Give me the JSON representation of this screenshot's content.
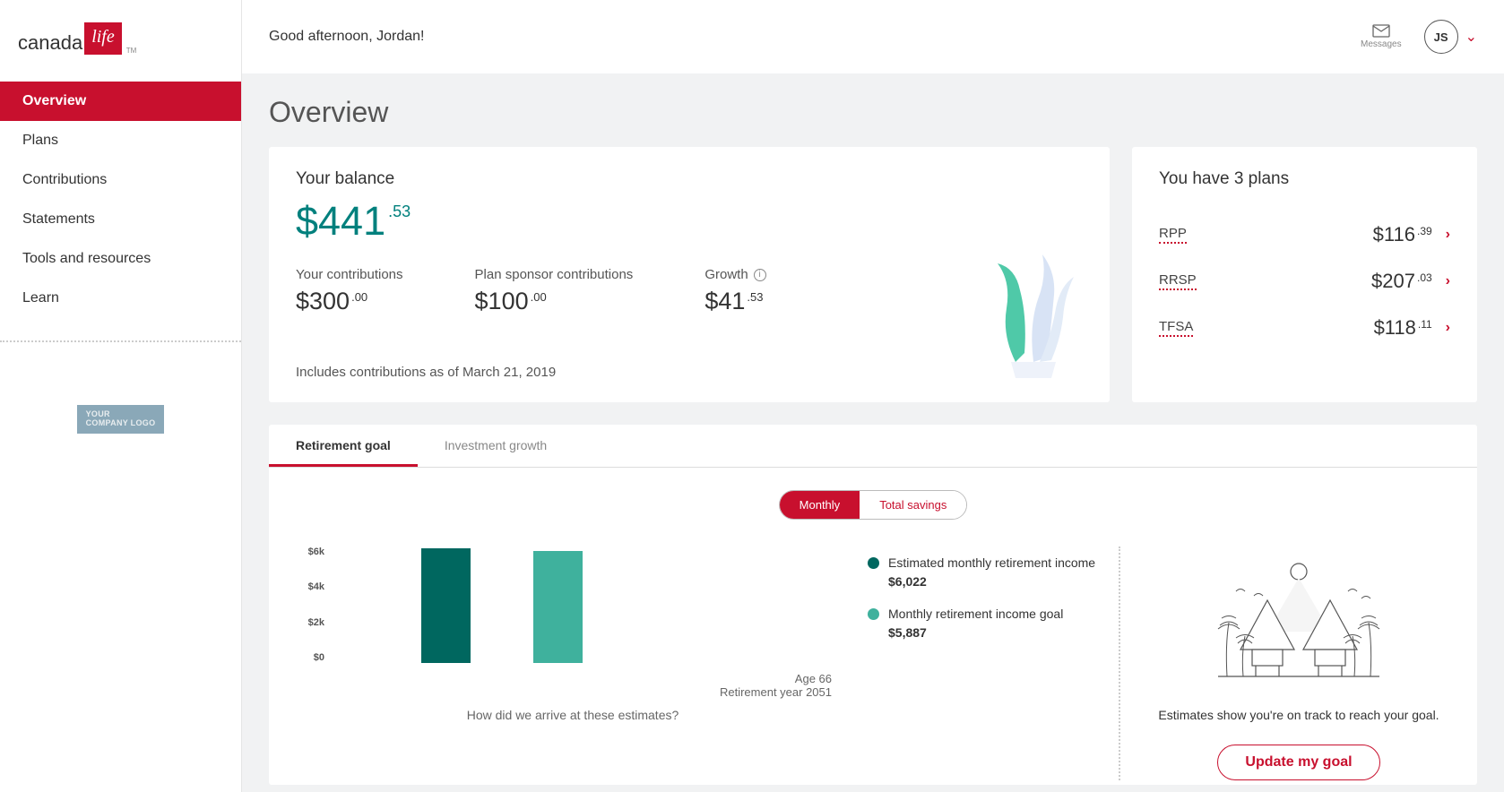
{
  "brand": {
    "part1": "canada",
    "part2": "life",
    "tm": "TM"
  },
  "nav": {
    "items": [
      {
        "label": "Overview",
        "active": true
      },
      {
        "label": "Plans"
      },
      {
        "label": "Contributions"
      },
      {
        "label": "Statements"
      },
      {
        "label": "Tools and resources"
      },
      {
        "label": "Learn"
      }
    ]
  },
  "company_logo": {
    "line1": "YOUR",
    "line2": "COMPANY LOGO"
  },
  "header": {
    "greeting": "Good afternoon, Jordan!",
    "messages_label": "Messages",
    "avatar_initials": "JS"
  },
  "page": {
    "title": "Overview"
  },
  "balance": {
    "label": "Your balance",
    "whole": "$441",
    "cents": ".53",
    "contrib_label": "Your contributions",
    "contrib_whole": "$300",
    "contrib_cents": ".00",
    "sponsor_label": "Plan sponsor contributions",
    "sponsor_whole": "$100",
    "sponsor_cents": ".00",
    "growth_label": "Growth",
    "growth_whole": "$41",
    "growth_cents": ".53",
    "note": "Includes contributions as of March 21, 2019"
  },
  "plans": {
    "title": "You have 3 plans",
    "items": [
      {
        "name": "RPP",
        "whole": "$116",
        "cents": ".39"
      },
      {
        "name": "RRSP",
        "whole": "$207",
        "cents": ".03"
      },
      {
        "name": "TFSA",
        "whole": "$118",
        "cents": ".11"
      }
    ]
  },
  "tabs": {
    "retirement": "Retirement goal",
    "investment": "Investment growth"
  },
  "toggle": {
    "monthly": "Monthly",
    "total": "Total savings"
  },
  "chart_data": {
    "type": "bar",
    "categories": [
      "Estimated monthly retirement income",
      "Monthly retirement income goal"
    ],
    "values": [
      6022,
      5887
    ],
    "value_labels": [
      "$6,022",
      "$5,887"
    ],
    "ylim": [
      0,
      6000
    ],
    "y_ticks": [
      "$0",
      "$2k",
      "$4k",
      "$6k"
    ],
    "colors": [
      "#00675f",
      "#3fb19d"
    ],
    "x_label_line1": "Age 66",
    "x_label_line2": "Retirement year 2051"
  },
  "estimates_link": "How did we arrive at these estimates?",
  "goal": {
    "text": "Estimates show you're on track to reach your goal.",
    "button": "Update my goal"
  }
}
